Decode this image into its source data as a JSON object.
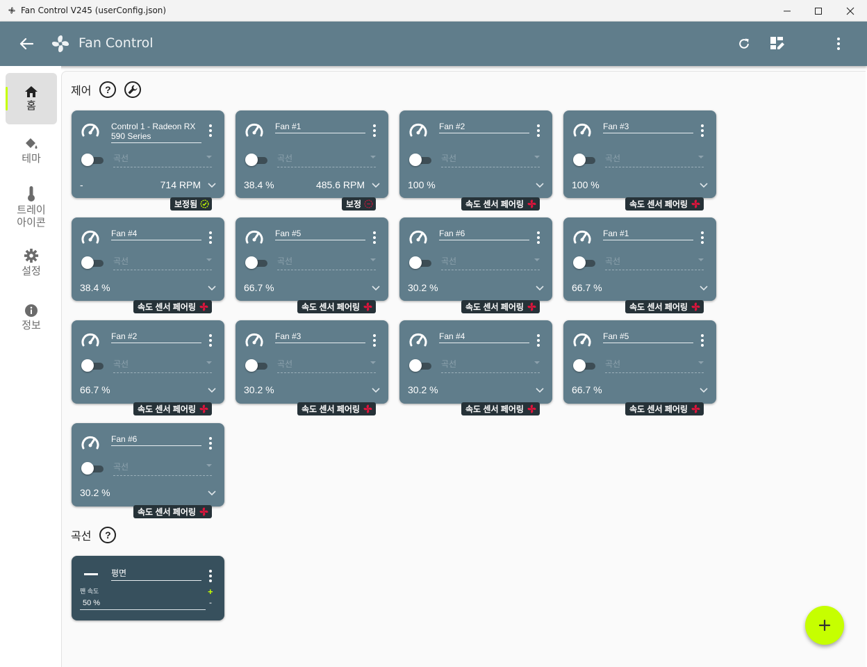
{
  "window": {
    "title": "Fan Control V245 (userConfig.json)"
  },
  "appbar": {
    "title": "Fan Control"
  },
  "sidebar": {
    "items": [
      {
        "label": "홈",
        "icon": "home-icon"
      },
      {
        "label": "테마",
        "icon": "paint-bucket-icon"
      },
      {
        "label": "트레이\n아이콘",
        "icon": "thermometer-icon"
      },
      {
        "label": "설정",
        "icon": "gear-icon"
      },
      {
        "label": "정보",
        "icon": "info-icon"
      }
    ]
  },
  "controls": {
    "heading": "제어",
    "help": "?",
    "cards": [
      {
        "name": "Control 1 - Radeon RX 590 Series",
        "curve": "곡선",
        "percent": "-",
        "rpm": "714 RPM",
        "badge": "보정됨",
        "badge_icon": "check-circle-icon"
      },
      {
        "name": "Fan #1",
        "curve": "곡선",
        "percent": "38.4 %",
        "rpm": "485.6 RPM",
        "badge": "보정",
        "badge_icon": "not-calibrated-icon"
      },
      {
        "name": "Fan #2",
        "curve": "곡선",
        "percent": "100 %",
        "rpm": "",
        "badge": "속도 센서 페어링",
        "badge_icon": "fan-icon"
      },
      {
        "name": "Fan #3",
        "curve": "곡선",
        "percent": "100 %",
        "rpm": "",
        "badge": "속도 센서 페어링",
        "badge_icon": "fan-icon"
      },
      {
        "name": "Fan #4",
        "curve": "곡선",
        "percent": "38.4 %",
        "rpm": "",
        "badge": "속도 센서 페어링",
        "badge_icon": "fan-icon"
      },
      {
        "name": "Fan #5",
        "curve": "곡선",
        "percent": "66.7 %",
        "rpm": "",
        "badge": "속도 센서 페어링",
        "badge_icon": "fan-icon"
      },
      {
        "name": "Fan #6",
        "curve": "곡선",
        "percent": "30.2 %",
        "rpm": "",
        "badge": "속도 센서 페어링",
        "badge_icon": "fan-icon"
      },
      {
        "name": "Fan #1",
        "curve": "곡선",
        "percent": "66.7 %",
        "rpm": "",
        "badge": "속도 센서 페어링",
        "badge_icon": "fan-icon"
      },
      {
        "name": "Fan #2",
        "curve": "곡선",
        "percent": "66.7 %",
        "rpm": "",
        "badge": "속도 센서 페어링",
        "badge_icon": "fan-icon"
      },
      {
        "name": "Fan #3",
        "curve": "곡선",
        "percent": "30.2 %",
        "rpm": "",
        "badge": "속도 센서 페어링",
        "badge_icon": "fan-icon"
      },
      {
        "name": "Fan #4",
        "curve": "곡선",
        "percent": "30.2 %",
        "rpm": "",
        "badge": "속도 센서 페어링",
        "badge_icon": "fan-icon"
      },
      {
        "name": "Fan #5",
        "curve": "곡선",
        "percent": "66.7 %",
        "rpm": "",
        "badge": "속도 센서 페어링",
        "badge_icon": "fan-icon"
      },
      {
        "name": "Fan #6",
        "curve": "곡선",
        "percent": "30.2 %",
        "rpm": "",
        "badge": "속도 센서 페어링",
        "badge_icon": "fan-icon"
      }
    ]
  },
  "curves": {
    "heading": "곡선",
    "help": "?",
    "card": {
      "name": "평면",
      "label": "팬 속도",
      "value": "50 %",
      "plus": "+",
      "minus": "-"
    }
  },
  "colors": {
    "accent": "#c6ff00",
    "card": "#607d8b",
    "appbar": "#607d8b",
    "badge": "#263238",
    "curve_card": "#37505d"
  }
}
